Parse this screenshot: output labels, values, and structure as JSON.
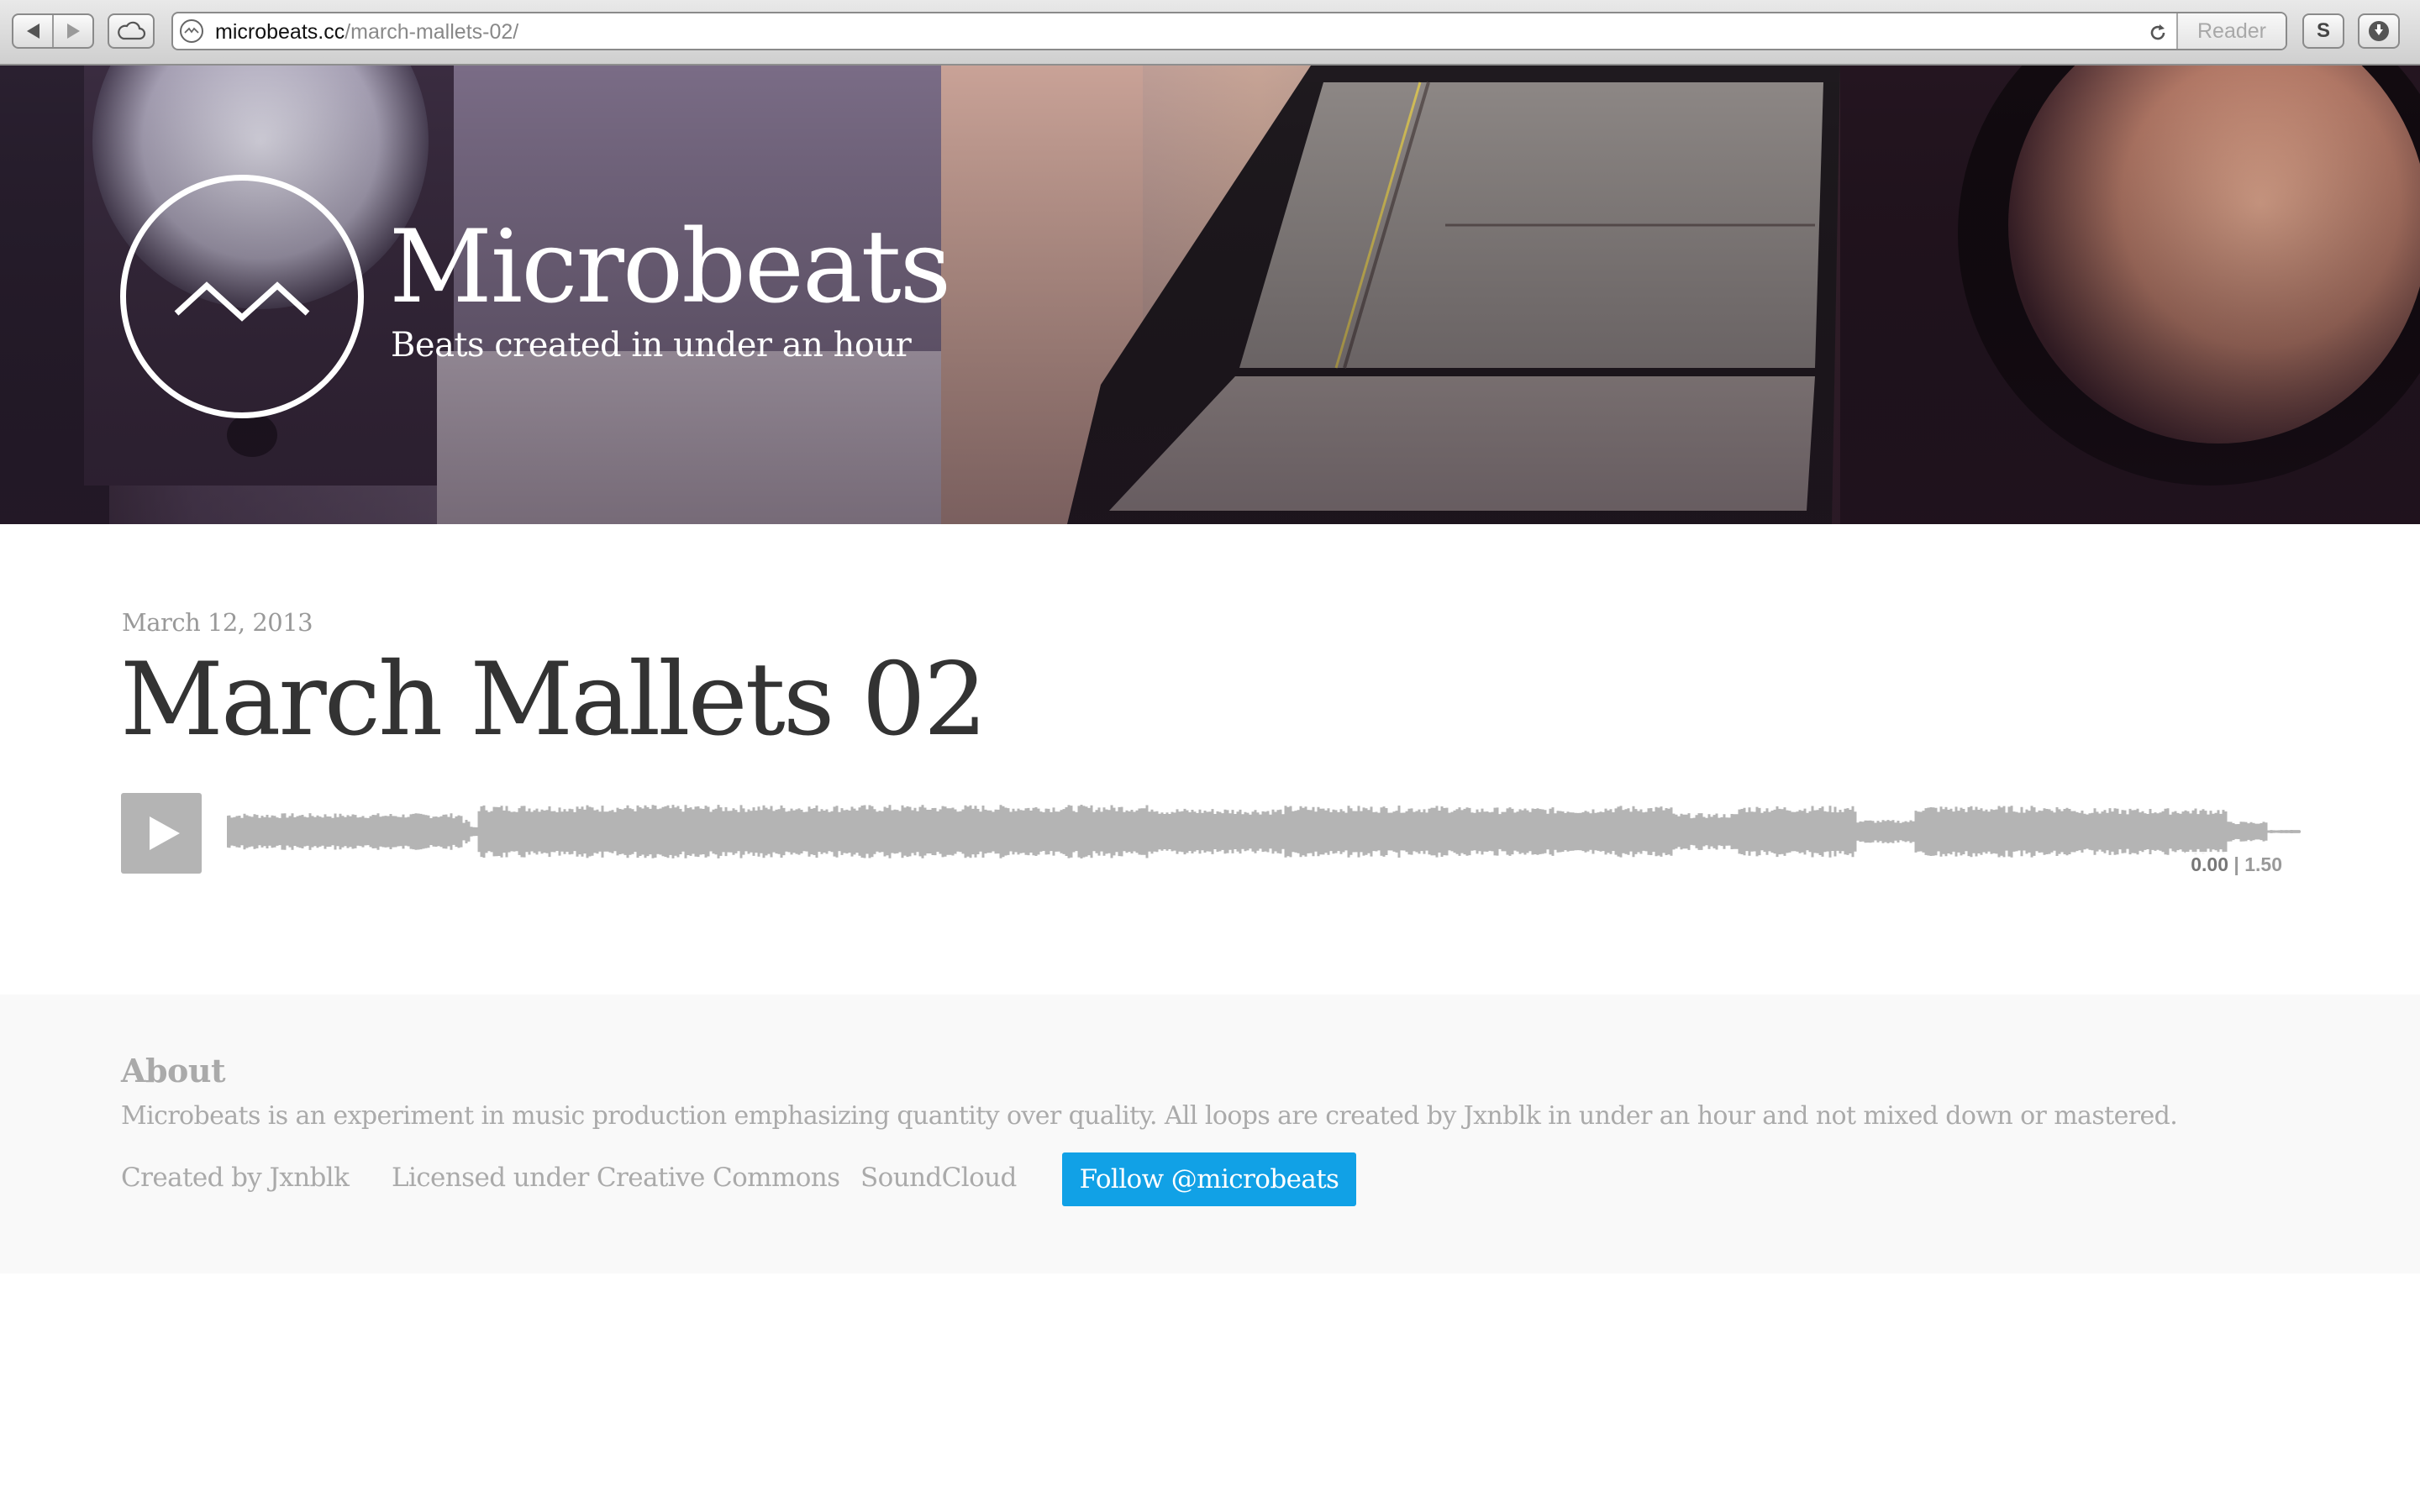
{
  "browser": {
    "url_domain": "microbeats.cc",
    "url_path": "/march-mallets-02/",
    "reader_label": "Reader",
    "extension_label": "S"
  },
  "header": {
    "site_title": "Microbeats",
    "tagline": "Beats created in under an hour"
  },
  "post": {
    "date": "March 12, 2013",
    "title": "March Mallets 02"
  },
  "player": {
    "current_time": "0.00",
    "separator": " | ",
    "duration": "1.50",
    "progress_fraction": 0,
    "waveform_color": "#b4b4b4"
  },
  "footer": {
    "about_heading": "About",
    "about_text": "Microbeats is an experiment in music production emphasizing quantity over quality. All loops are created by Jxnblk in under an hour and not mixed down or mastered.",
    "links": {
      "created_by": "Created by Jxnblk",
      "license": "Licensed under Creative Commons",
      "soundcloud": "SoundCloud"
    },
    "follow_button": "Follow @microbeats",
    "follow_color": "#11a1e6"
  }
}
